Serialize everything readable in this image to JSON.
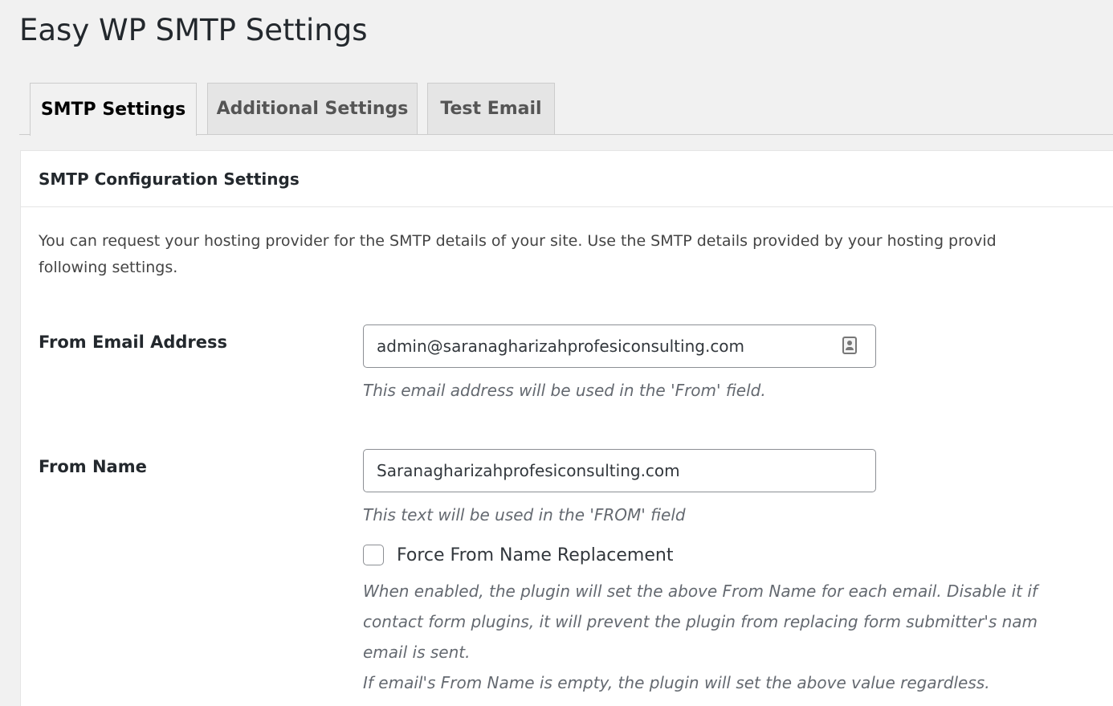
{
  "page": {
    "title": "Easy WP SMTP Settings"
  },
  "tabs": [
    {
      "label": "SMTP Settings",
      "active": true
    },
    {
      "label": "Additional Settings",
      "active": false
    },
    {
      "label": "Test Email",
      "active": false
    }
  ],
  "panel": {
    "title": "SMTP Configuration Settings",
    "intro_lines": [
      "You can request your hosting provider for the SMTP details of your site. Use the SMTP details provided by your hosting provid",
      "following settings."
    ]
  },
  "fields": {
    "from_email": {
      "label": "From Email Address",
      "value": "admin@saranagharizahprofesiconsulting.com",
      "description": "This email address will be used in the 'From' field.",
      "icon": "contact-card-icon"
    },
    "from_name": {
      "label": "From Name",
      "value": "Saranagharizahprofesiconsulting.com",
      "description": "This text will be used in the 'FROM' field"
    },
    "force_from_name": {
      "label": "Force From Name Replacement",
      "checked": false,
      "description_lines": [
        "When enabled, the plugin will set the above From Name for each email. Disable it if",
        "contact form plugins, it will prevent the plugin from replacing form submitter's nam",
        "email is sent.",
        "If email's From Name is empty, the plugin will set the above value regardless."
      ]
    }
  }
}
